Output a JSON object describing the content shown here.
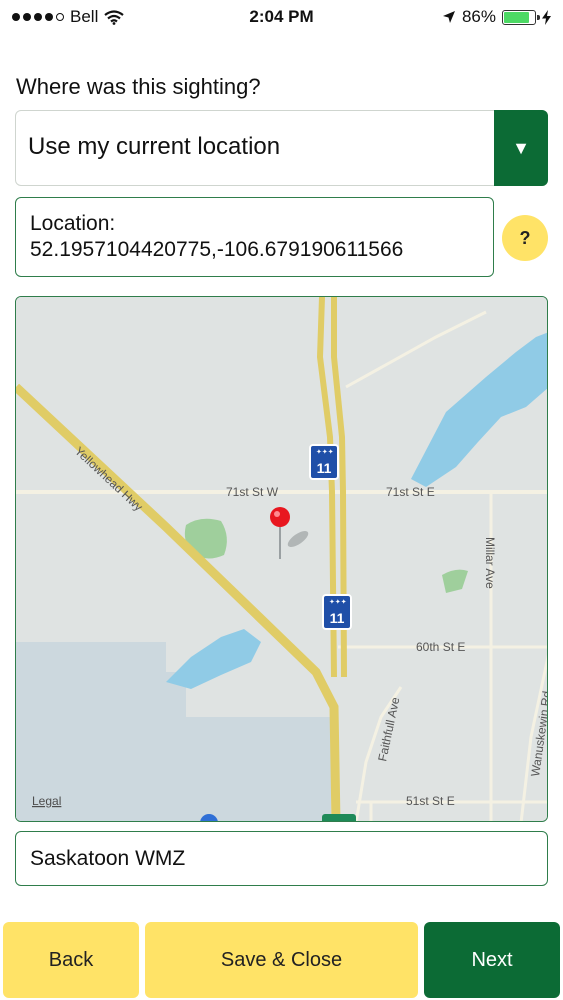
{
  "status_bar": {
    "carrier": "Bell",
    "time": "2:04 PM",
    "battery_percent": "86%",
    "battery_level": 0.86,
    "icons": [
      "signal-dots-icon",
      "wifi-icon",
      "location-arrow-icon",
      "battery-icon",
      "charging-bolt-icon"
    ]
  },
  "form": {
    "question": "Where was this sighting?",
    "location_select": {
      "selected": "Use my current location",
      "dropdown_icon": "caret-down-icon"
    },
    "location_field": {
      "label": "Location:",
      "value": "52.1957104420775,-106.679190611566"
    },
    "help_label": "?",
    "zone_field": {
      "value": "Saskatoon WMZ"
    }
  },
  "map": {
    "street_labels": {
      "yellowhead": "Yellowhead Hwy",
      "w71": "71st St W",
      "e71": "71st St E",
      "e60": "60th St E",
      "e51": "51st St E",
      "millar": "Millar Ave",
      "faithfull": "Faithfull Ave",
      "wanuskewin": "Wanuskewin Rd"
    },
    "highway_shield": "11",
    "legal_link": "Legal",
    "pin_icon": "map-pin-icon",
    "colors": {
      "land": "#dfe3e2",
      "water": "#90cbe6",
      "park": "#9fcf9c",
      "highway": "#e0cc66",
      "road": "#f4f1e3"
    }
  },
  "footer": {
    "back": "Back",
    "save_close": "Save & Close",
    "next": "Next"
  },
  "colors": {
    "brand_green": "#0c6b35",
    "accent_yellow": "#ffe367",
    "border_green": "#2f7d4b"
  }
}
